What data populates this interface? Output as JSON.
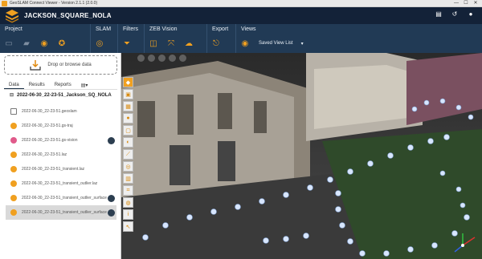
{
  "titlebar": {
    "title": "GeoSLAM Connect Viewer - Version 2.1.1 (2.0.0)",
    "minimize": "—",
    "maximize": "☐",
    "close": "✕"
  },
  "header": {
    "project_name": "JACKSON_SQUARE_NOLA"
  },
  "ribbon": {
    "groups": [
      {
        "label": "Project"
      },
      {
        "label": "SLAM"
      },
      {
        "label": "Filters"
      },
      {
        "label": "ZEB Vision"
      },
      {
        "label": "Export"
      },
      {
        "label": "Views"
      }
    ],
    "saved_view_label": "Saved View List"
  },
  "left": {
    "dropzone_label": "Drop or browse data",
    "tabs": [
      "Data",
      "Results",
      "Reports"
    ],
    "root_label": "2022-06-30_22-23-51_Jackson_SQ_NOLA",
    "files": [
      {
        "name": "2022-06-30_22-23-51.geoslam",
        "icon": "grey"
      },
      {
        "name": "2022-06-30_22-23-51.gs-traj",
        "icon": "orange"
      },
      {
        "name": "2022-06-30_22-23-51.gs-vision",
        "icon": "pink",
        "badge": true
      },
      {
        "name": "2022-06-30_22-23-51.laz",
        "icon": "orange"
      },
      {
        "name": "2022-06-30_22-23-51_transient.laz",
        "icon": "orange"
      },
      {
        "name": "2022-06-30_22-23-51_transient_outlier.laz",
        "icon": "orange"
      },
      {
        "name": "2022-06-30_22-23-51_transient_outlier_surface",
        "icon": "orange",
        "badge": true
      },
      {
        "name": "2022-06-30_22-23-51_transient_outlier_surface",
        "icon": "orange",
        "badge": true,
        "selected": true
      }
    ]
  },
  "colors": {
    "header": "#132238",
    "ribbon": "#213a55",
    "accent": "#f0a020"
  }
}
